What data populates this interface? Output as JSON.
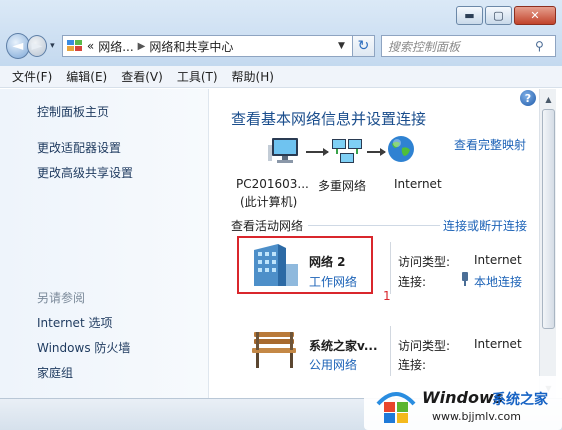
{
  "window": {
    "minimize": "▬",
    "maximize": "▢",
    "close": "✕"
  },
  "nav": {
    "back": "◄",
    "forward": "►",
    "dropdown": "▾",
    "breadcrumb": [
      "«",
      "网络...",
      "网络和共享中心"
    ],
    "refresh": "↻",
    "search_placeholder": "搜索控制面板"
  },
  "menu": [
    "文件(F)",
    "编辑(E)",
    "查看(V)",
    "工具(T)",
    "帮助(H)"
  ],
  "sidebar": {
    "items": [
      "控制面板主页",
      "更改适配器设置",
      "更改高级共享设置"
    ],
    "see_also_label": "另请参阅",
    "see_also": [
      "Internet 选项",
      "Windows 防火墙",
      "家庭组"
    ]
  },
  "main": {
    "heading": "查看基本网络信息并设置连接",
    "full_map": "查看完整映射",
    "map": {
      "pc_line1": "PC201603...",
      "pc_line2": "(此计算机)",
      "network": "多重网络",
      "internet": "Internet"
    },
    "active_header": "查看活动网络",
    "connect_link": "连接或断开连接",
    "networks": [
      {
        "name": "网络  2",
        "type": "工作网络",
        "access_label": "访问类型:",
        "access": "Internet",
        "conn_label": "连接:",
        "conn": "本地连接"
      },
      {
        "name": "系统之家v...",
        "type": "公用网络",
        "access_label": "访问类型:",
        "access": "Internet",
        "conn_label": "连接:",
        "conn": ""
      }
    ],
    "annotation": "1"
  },
  "help": "?",
  "watermark": {
    "title": "Windows",
    "subtitle": "系统之家",
    "url": "www.bjjmlv.com"
  },
  "colors": {
    "link": "#1d63b7",
    "heading": "#1a4d8c",
    "highlight": "#d9262c"
  }
}
